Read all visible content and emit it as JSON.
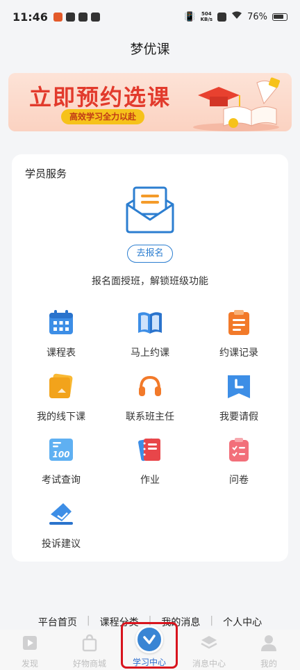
{
  "status_bar": {
    "time": "11:46",
    "speed_top": "504",
    "speed_bottom": "KB/s",
    "battery": "76%"
  },
  "header": {
    "title": "梦优课"
  },
  "banner": {
    "title": "立即预约选课",
    "subtitle": "高效学习全力以赴"
  },
  "service": {
    "title": "学员服务",
    "signup_label": "去报名",
    "signup_tip": "报名面授班，解锁班级功能",
    "items": [
      {
        "label": "课程表",
        "icon": "calendar-icon"
      },
      {
        "label": "马上约课",
        "icon": "book-icon"
      },
      {
        "label": "约课记录",
        "icon": "clipboard-icon"
      },
      {
        "label": "我的线下课",
        "icon": "folder-icon"
      },
      {
        "label": "联系班主任",
        "icon": "headset-icon"
      },
      {
        "label": "我要请假",
        "icon": "clock-bookmark-icon"
      },
      {
        "label": "考试查询",
        "icon": "score-icon"
      },
      {
        "label": "作业",
        "icon": "notebook-icon"
      },
      {
        "label": "问卷",
        "icon": "checklist-icon"
      },
      {
        "label": "投诉建议",
        "icon": "envelope-send-icon"
      }
    ]
  },
  "tab_links": [
    "平台首页",
    "课程分类",
    "我的消息",
    "个人中心"
  ],
  "bottom_nav": [
    {
      "label": "发现",
      "icon": "play-icon"
    },
    {
      "label": "好物商城",
      "icon": "bag-icon"
    },
    {
      "label": "学习中心",
      "icon": "check-icon",
      "active": true
    },
    {
      "label": "消息中心",
      "icon": "layers-icon"
    },
    {
      "label": "我的",
      "icon": "user-icon"
    }
  ],
  "colors": {
    "accent": "#2f80d3",
    "highlight": "#d8141e",
    "banner_text": "#e23a2c"
  }
}
